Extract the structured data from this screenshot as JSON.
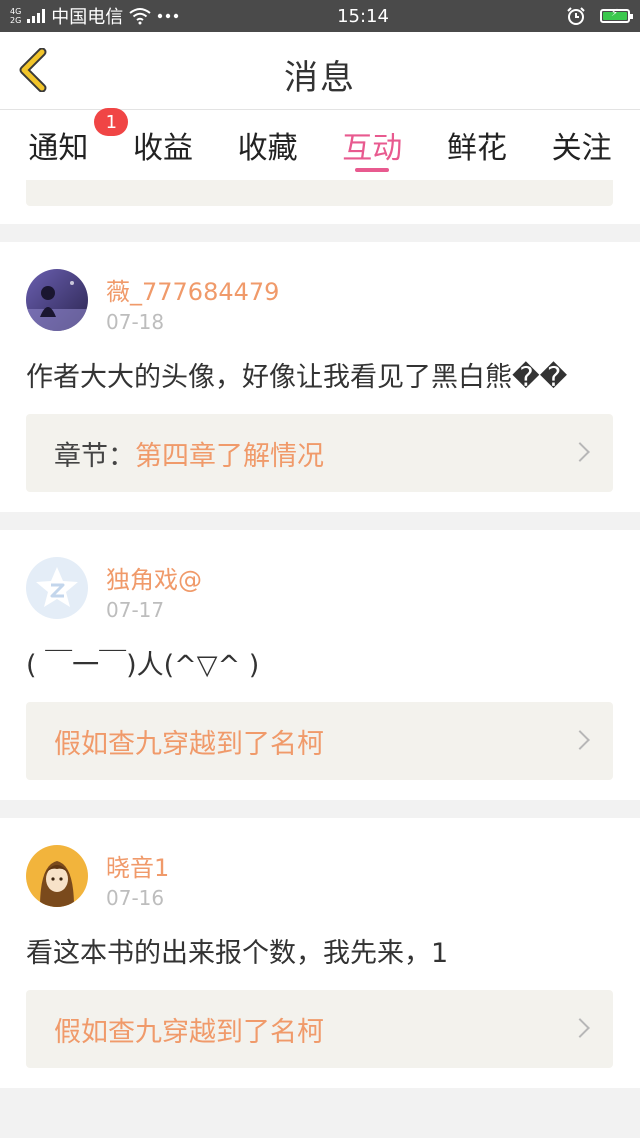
{
  "status_bar": {
    "network_type_top": "4G",
    "network_type_bottom": "2G",
    "carrier": "中国电信",
    "time": "15:14"
  },
  "header": {
    "title": "消息"
  },
  "tabs": [
    {
      "label": "通知",
      "badge": "1",
      "active": false
    },
    {
      "label": "收益",
      "active": false
    },
    {
      "label": "收藏",
      "active": false
    },
    {
      "label": "互动",
      "active": true
    },
    {
      "label": "鲜花",
      "active": false
    },
    {
      "label": "关注",
      "active": false
    }
  ],
  "messages": [
    {
      "user": "薇_777684479",
      "date": "07-18",
      "text": "作者大大的头像，好像让我看见了黑白熊��",
      "ref_prefix": "章节：",
      "ref_title": "第四章了解情况"
    },
    {
      "user": "独角戏@",
      "date": "07-17",
      "text": "( ￣一￣)人(^▽^ )",
      "ref_prefix": "",
      "ref_title": "假如查九穿越到了名柯"
    },
    {
      "user": "晓音1",
      "date": "07-16",
      "text": "看这本书的出来报个数，我先来，1",
      "ref_prefix": "",
      "ref_title": "假如查九穿越到了名柯"
    }
  ],
  "colors": {
    "accent_pink": "#e85a8f",
    "username_orange": "#f09a6a",
    "badge_red": "#f04545",
    "back_arrow_yellow": "#f2c52b"
  }
}
